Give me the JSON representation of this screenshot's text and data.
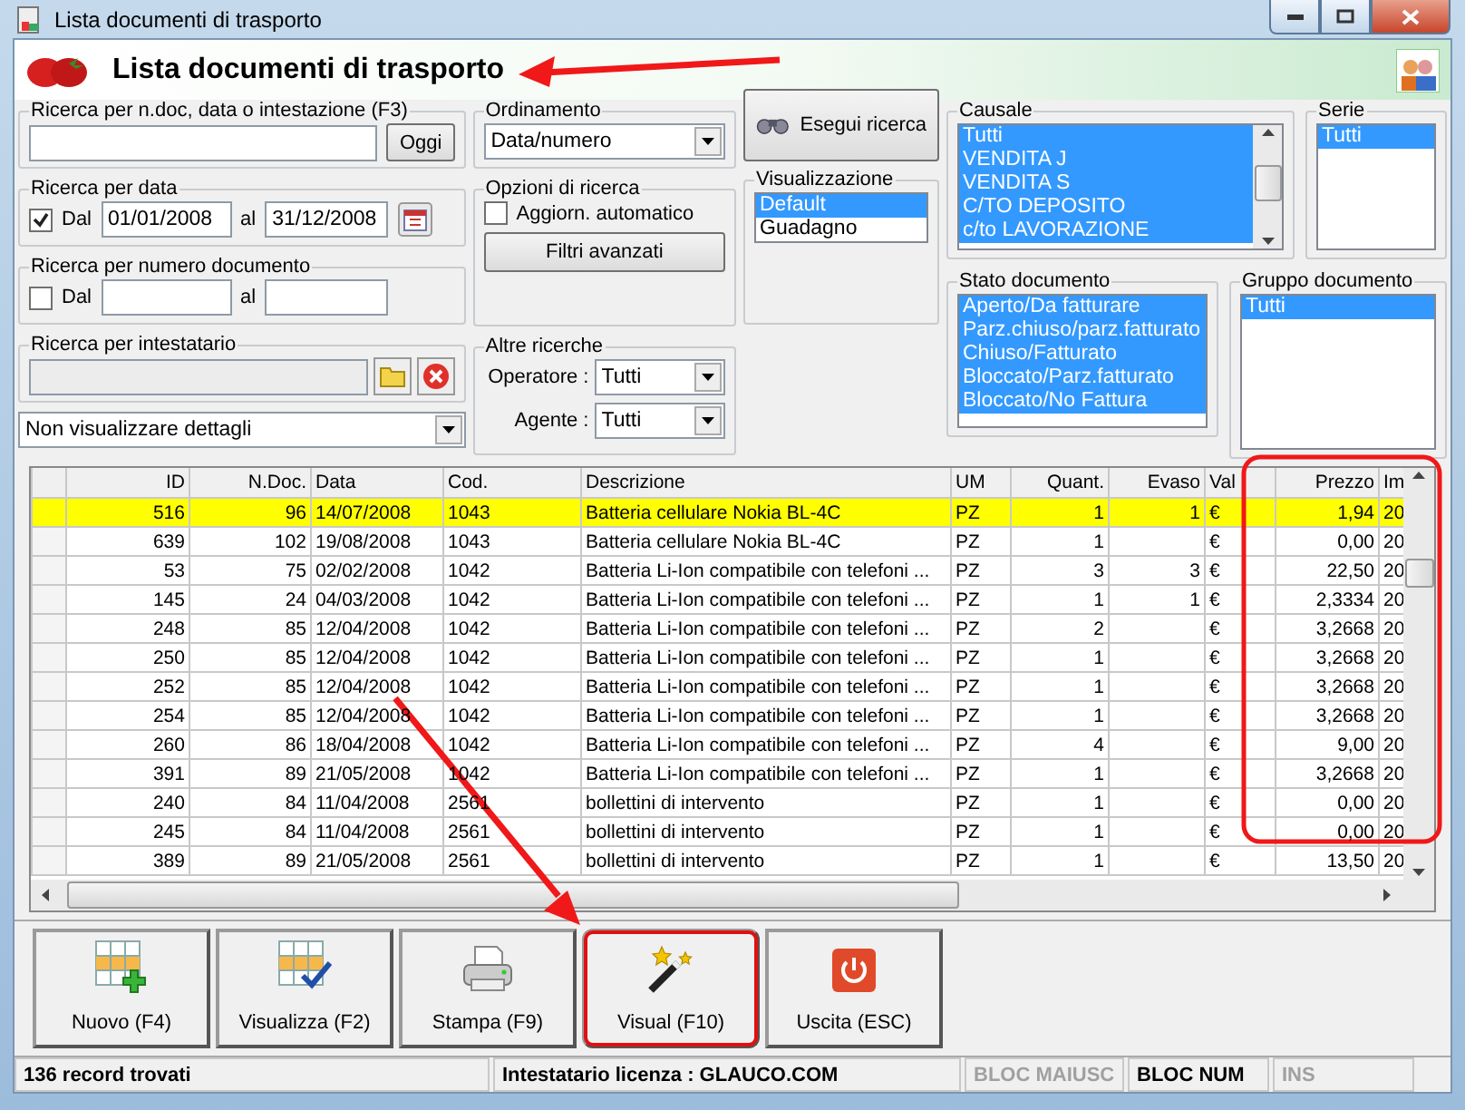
{
  "window": {
    "title": "Lista documenti di trasporto"
  },
  "header": {
    "title": "Lista documenti di trasporto"
  },
  "search_text": {
    "label": "Ricerca per n.doc, data o intestazione (F3)",
    "button": "Oggi"
  },
  "date_search": {
    "label": "Ricerca per data",
    "checked": true,
    "from_label": "Dal",
    "from": "01/01/2008",
    "to_label": "al",
    "to": "31/12/2008"
  },
  "number_search": {
    "label": "Ricerca per numero documento",
    "checked": false,
    "from_label": "Dal",
    "to_label": "al"
  },
  "holder_search": {
    "label": "Ricerca per intestatario"
  },
  "details_select": {
    "value": "Non visualizzare dettagli"
  },
  "ordering": {
    "label": "Ordinamento",
    "value": "Data/numero"
  },
  "search_options": {
    "label": "Opzioni di ricerca",
    "auto_update": {
      "label": "Aggiorn. automatico",
      "checked": false
    },
    "advanced_button": "Filtri avanzati"
  },
  "other_searches": {
    "label": "Altre ricerche",
    "fields": [
      {
        "label": "Operatore :",
        "value": "Tutti"
      },
      {
        "label": "Agente :",
        "value": "Tutti"
      }
    ]
  },
  "run_search_button": "Esegui ricerca",
  "view": {
    "label": "Visualizzazione",
    "items": [
      {
        "label": "Default",
        "selected": true
      },
      {
        "label": "Guadagno",
        "selected": false
      }
    ]
  },
  "causale": {
    "label": "Causale",
    "items": [
      {
        "label": "Tutti",
        "selected": true
      },
      {
        "label": "VENDITA J",
        "selected": true
      },
      {
        "label": "VENDITA S",
        "selected": true
      },
      {
        "label": "C/TO DEPOSITO",
        "selected": true
      },
      {
        "label": "c/to LAVORAZIONE",
        "selected": true
      }
    ]
  },
  "serie": {
    "label": "Serie",
    "items": [
      {
        "label": "Tutti",
        "selected": true
      }
    ]
  },
  "document_state": {
    "label": "Stato documento",
    "items": [
      {
        "label": "Aperto/Da fatturare",
        "selected": true
      },
      {
        "label": "Parz.chiuso/parz.fatturato",
        "selected": true
      },
      {
        "label": "Chiuso/Fatturato",
        "selected": true
      },
      {
        "label": "Bloccato/Parz.fatturato",
        "selected": true
      },
      {
        "label": "Bloccato/No Fattura",
        "selected": true
      }
    ]
  },
  "document_group": {
    "label": "Gruppo documento",
    "items": [
      {
        "label": "Tutti",
        "selected": true
      }
    ]
  },
  "table": {
    "columns": [
      {
        "label": "ID",
        "numeric": true
      },
      {
        "label": "N.Doc.",
        "numeric": true
      },
      {
        "label": "Data",
        "numeric": false
      },
      {
        "label": "Cod.",
        "numeric": false
      },
      {
        "label": "Descrizione",
        "numeric": false
      },
      {
        "label": "UM",
        "numeric": false
      },
      {
        "label": "Quant.",
        "numeric": true
      },
      {
        "label": "Evaso",
        "numeric": true
      },
      {
        "label": "Val",
        "numeric": false
      },
      {
        "label": "Prezzo",
        "numeric": true
      },
      {
        "label": "Im",
        "numeric": false
      }
    ],
    "rows": [
      {
        "selected": true,
        "cells": [
          "516",
          "96",
          "14/07/2008",
          "1043",
          "Batteria cellulare Nokia BL-4C",
          "PZ",
          "1",
          "1",
          "€",
          "1,94",
          "20"
        ]
      },
      {
        "selected": false,
        "cells": [
          "639",
          "102",
          "19/08/2008",
          "1043",
          "Batteria cellulare Nokia BL-4C",
          "PZ",
          "1",
          null,
          "€",
          "0,00",
          "20"
        ]
      },
      {
        "selected": false,
        "cells": [
          "53",
          "75",
          "02/02/2008",
          "1042",
          "Batteria Li-Ion compatibile con telefoni ...",
          "PZ",
          "3",
          "3",
          "€",
          "22,50",
          "20"
        ]
      },
      {
        "selected": false,
        "cells": [
          "145",
          "24",
          "04/03/2008",
          "1042",
          "Batteria Li-Ion compatibile con telefoni ...",
          "PZ",
          "1",
          "1",
          "€",
          "2,3334",
          "20"
        ]
      },
      {
        "selected": false,
        "cells": [
          "248",
          "85",
          "12/04/2008",
          "1042",
          "Batteria Li-Ion compatibile con telefoni ...",
          "PZ",
          "2",
          null,
          "€",
          "3,2668",
          "20"
        ]
      },
      {
        "selected": false,
        "cells": [
          "250",
          "85",
          "12/04/2008",
          "1042",
          "Batteria Li-Ion compatibile con telefoni ...",
          "PZ",
          "1",
          null,
          "€",
          "3,2668",
          "20"
        ]
      },
      {
        "selected": false,
        "cells": [
          "252",
          "85",
          "12/04/2008",
          "1042",
          "Batteria Li-Ion compatibile con telefoni ...",
          "PZ",
          "1",
          null,
          "€",
          "3,2668",
          "20"
        ]
      },
      {
        "selected": false,
        "cells": [
          "254",
          "85",
          "12/04/2008",
          "1042",
          "Batteria Li-Ion compatibile con telefoni ...",
          "PZ",
          "1",
          null,
          "€",
          "3,2668",
          "20"
        ]
      },
      {
        "selected": false,
        "cells": [
          "260",
          "86",
          "18/04/2008",
          "1042",
          "Batteria Li-Ion compatibile con telefoni ...",
          "PZ",
          "4",
          null,
          "€",
          "9,00",
          "20"
        ]
      },
      {
        "selected": false,
        "cells": [
          "391",
          "89",
          "21/05/2008",
          "1042",
          "Batteria Li-Ion compatibile con telefoni ...",
          "PZ",
          "1",
          null,
          "€",
          "3,2668",
          "20"
        ]
      },
      {
        "selected": false,
        "cells": [
          "240",
          "84",
          "11/04/2008",
          "2561",
          "bollettini di intervento",
          "PZ",
          "1",
          null,
          "€",
          "0,00",
          "20"
        ]
      },
      {
        "selected": false,
        "cells": [
          "245",
          "84",
          "11/04/2008",
          "2561",
          "bollettini di intervento",
          "PZ",
          "1",
          null,
          "€",
          "0,00",
          "20"
        ]
      },
      {
        "selected": false,
        "cells": [
          "389",
          "89",
          "21/05/2008",
          "2561",
          "bollettini di intervento",
          "PZ",
          "1",
          null,
          "€",
          "13,50",
          "20"
        ]
      }
    ]
  },
  "toolbar": [
    {
      "label": "Nuovo (F4)",
      "kind": "new",
      "selected": false
    },
    {
      "label": "Visualizza (F2)",
      "kind": "view",
      "selected": false
    },
    {
      "label": "Stampa (F9)",
      "kind": "print",
      "selected": false
    },
    {
      "label": "Visual (F10)",
      "kind": "visual",
      "selected": true
    },
    {
      "label": "Uscita (ESC)",
      "kind": "exit",
      "selected": false
    }
  ],
  "status_bar": {
    "count": "136 record trovati",
    "license": "Intestatario licenza : GLAUCO.COM",
    "keys": [
      {
        "label": "BLOC MAIUSC",
        "on": false
      },
      {
        "label": "BLOC NUM",
        "on": true
      },
      {
        "label": "INS",
        "on": false
      }
    ]
  }
}
